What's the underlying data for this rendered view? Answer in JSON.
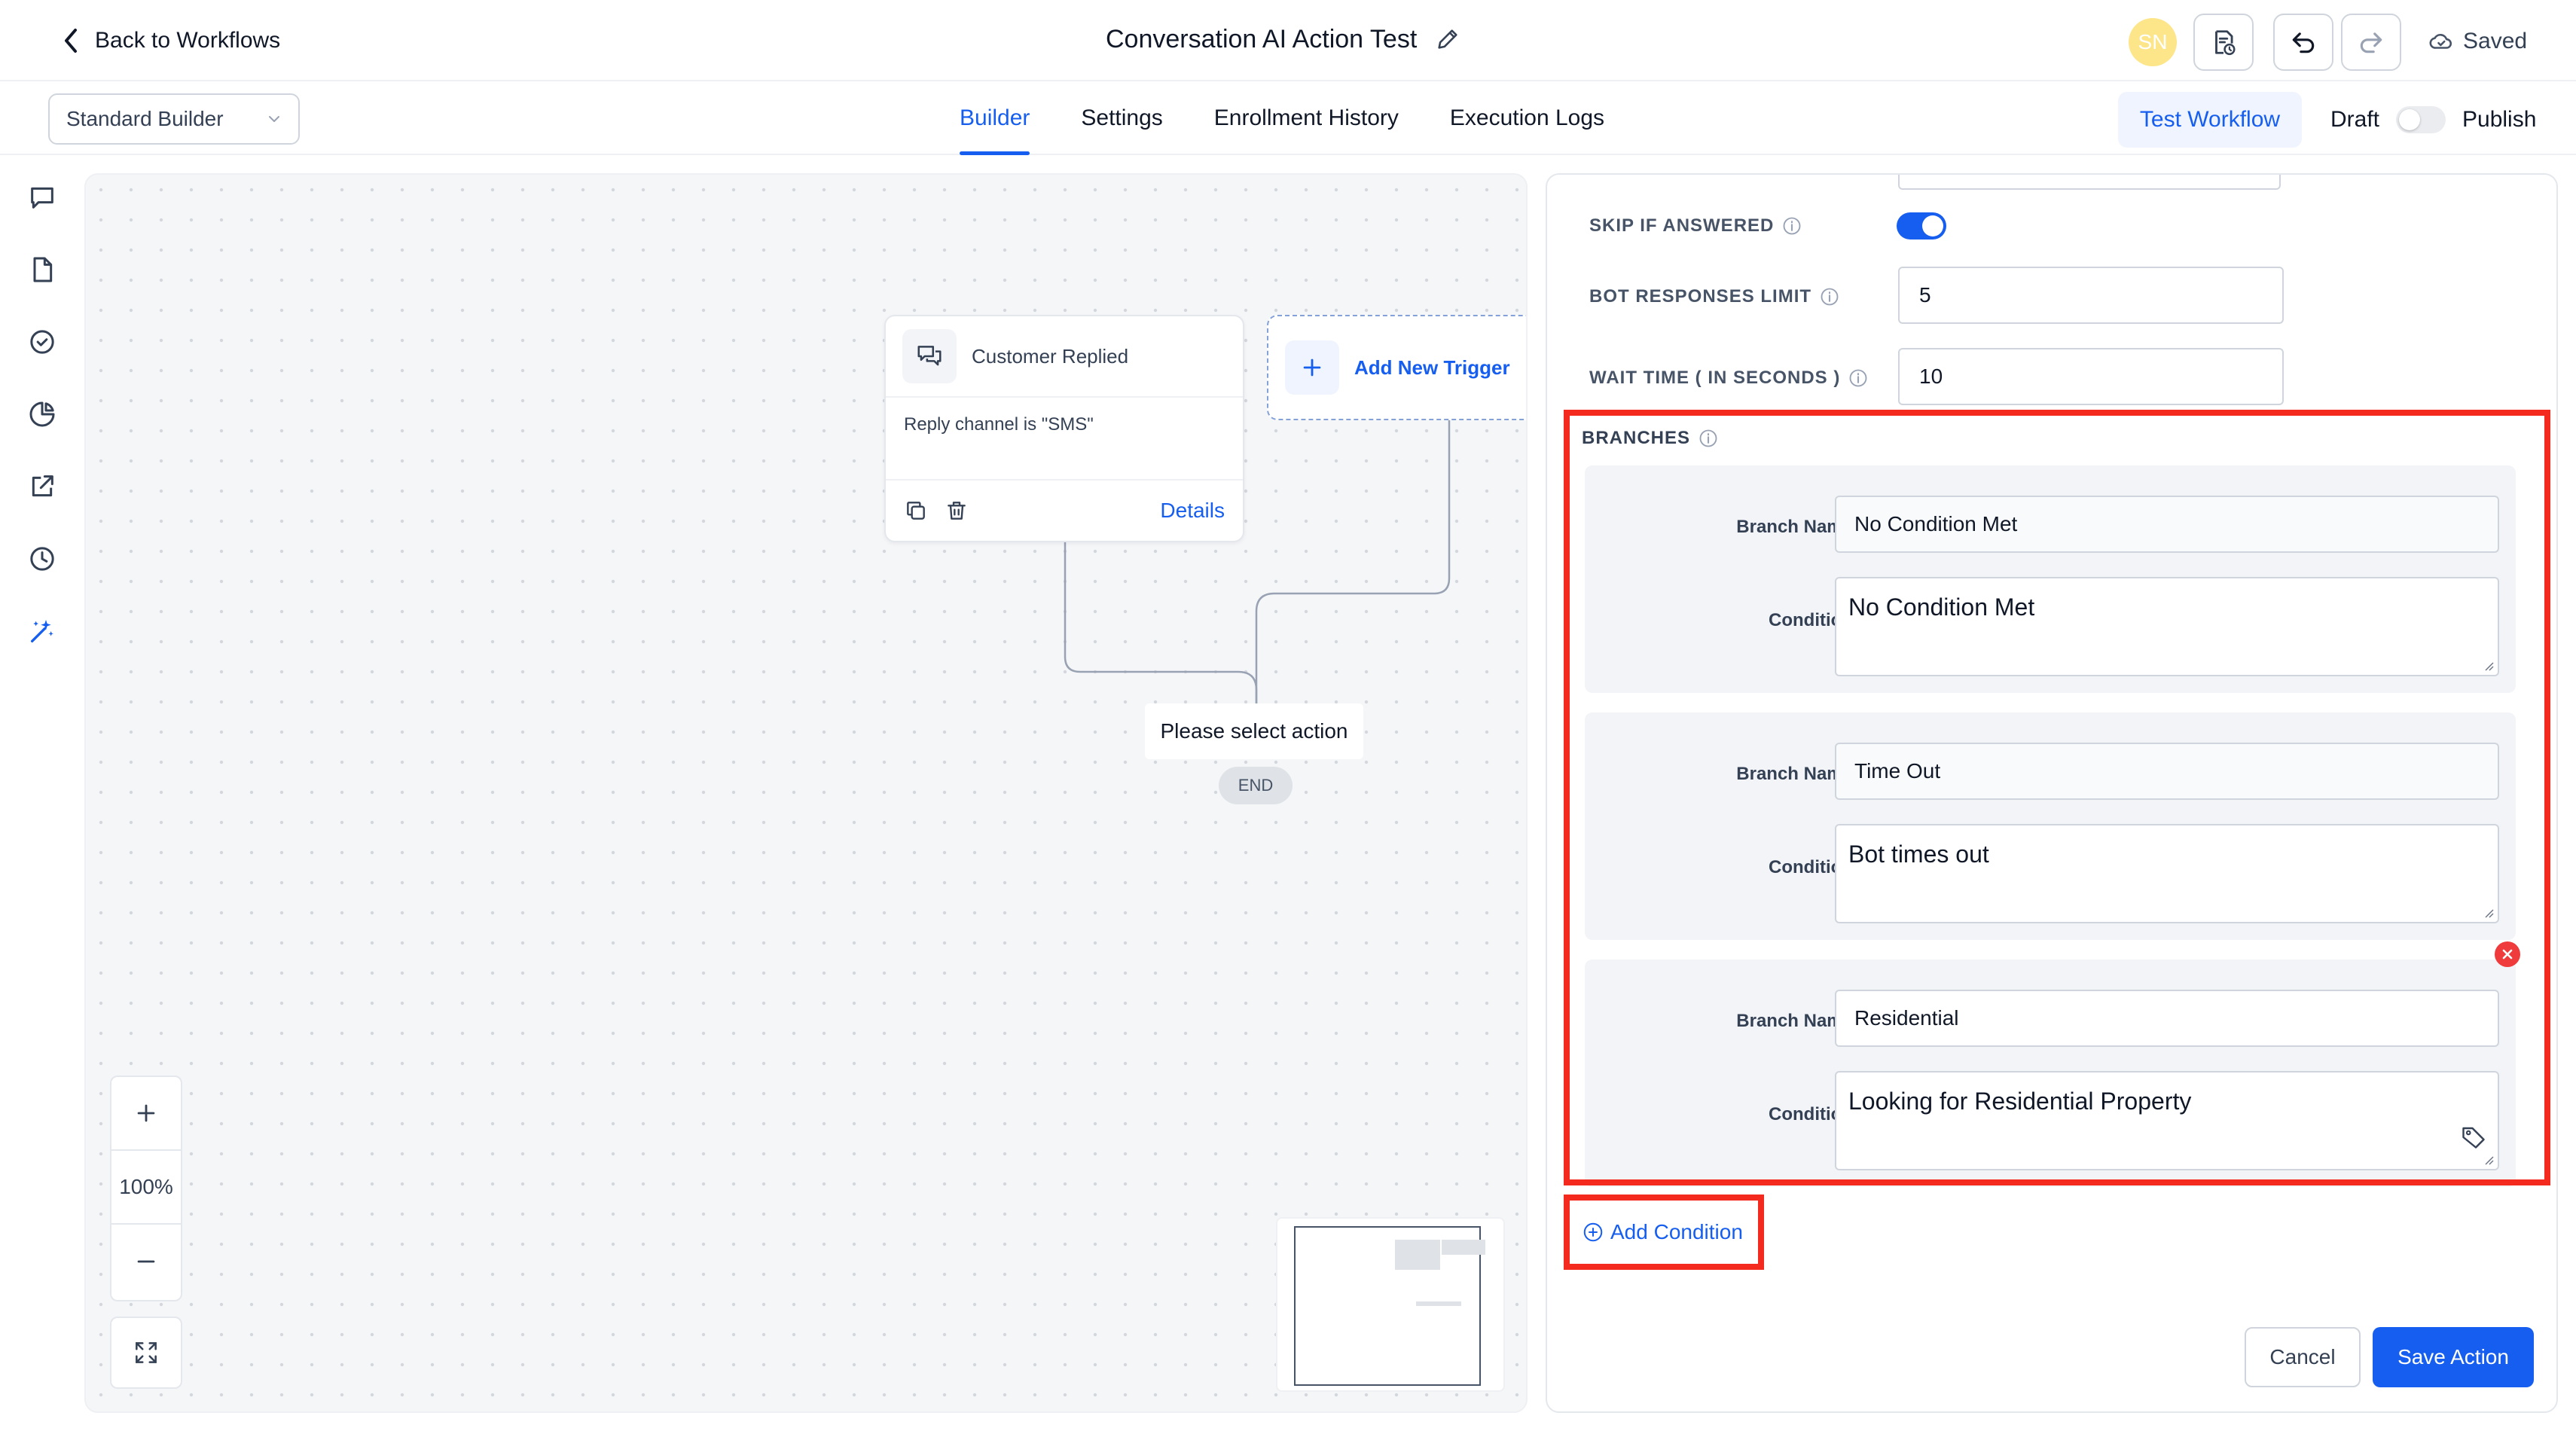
{
  "header": {
    "back_label": "Back to Workflows",
    "workflow_title": "Conversation AI Action Test",
    "avatar_initials": "SN",
    "saved_label": "Saved"
  },
  "subheader": {
    "builder_mode": "Standard Builder",
    "tabs": [
      {
        "label": "Builder",
        "active": true
      },
      {
        "label": "Settings",
        "active": false
      },
      {
        "label": "Enrollment History",
        "active": false
      },
      {
        "label": "Execution Logs",
        "active": false
      }
    ],
    "test_workflow_label": "Test Workflow",
    "draft_label": "Draft",
    "publish_label": "Publish"
  },
  "rail": {
    "icons": [
      "chat-icon",
      "document-icon",
      "check-circle-icon",
      "pie-chart-icon",
      "external-link-icon",
      "clock-icon",
      "ai-sparkle-icon"
    ]
  },
  "canvas": {
    "trigger": {
      "title": "Customer Replied",
      "filter": "Reply channel is \"SMS\"",
      "details_label": "Details"
    },
    "add_trigger_label": "Add New Trigger",
    "select_action_label": "Please select action",
    "end_label": "END",
    "zoom": {
      "in_label": "+",
      "level": "100%",
      "out_label": "−"
    }
  },
  "panel": {
    "skip_if_answered": {
      "label": "SKIP IF ANSWERED",
      "enabled": true
    },
    "bot_responses_limit": {
      "label": "BOT RESPONSES LIMIT",
      "value": "5"
    },
    "wait_time": {
      "label": "WAIT TIME ( IN SECONDS )",
      "value": "10"
    },
    "branches_title": "BRANCHES",
    "branch_name_label": "Branch Name",
    "condition_label": "Condition",
    "branches": [
      {
        "name": "No Condition Met",
        "condition": "No Condition Met"
      },
      {
        "name": "Time Out",
        "condition": "Bot times out"
      },
      {
        "name": "Residential",
        "condition": "Looking for Residential Property"
      }
    ],
    "add_condition_label": "Add Condition",
    "cancel_label": "Cancel",
    "save_label": "Save Action"
  },
  "colors": {
    "primary": "#155eef",
    "highlight_border": "#f52a1f",
    "remove": "#ef3b3b"
  }
}
